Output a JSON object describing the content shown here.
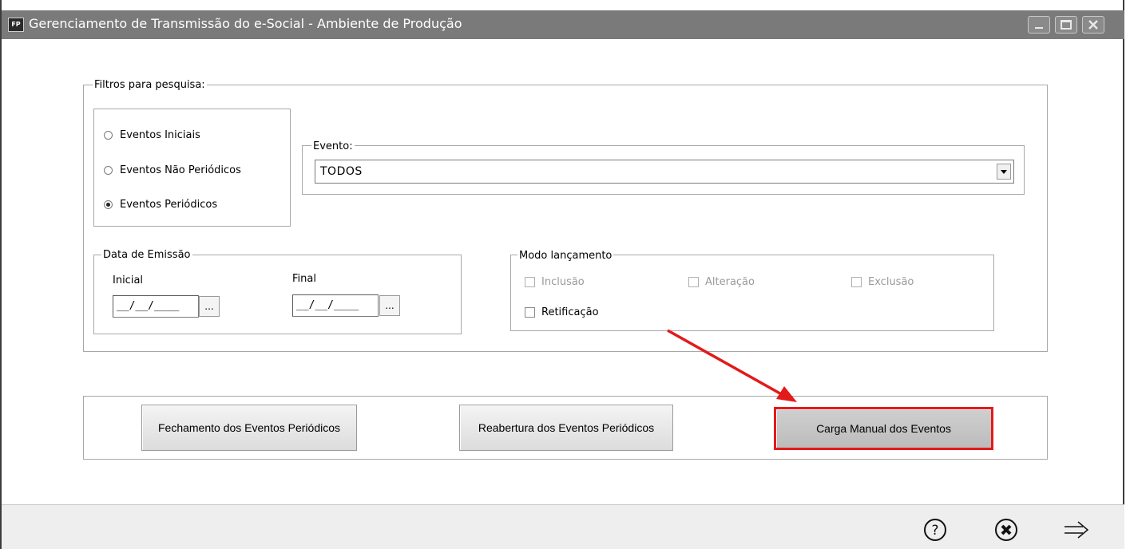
{
  "window": {
    "title": "Gerenciamento de Transmissão do e-Social - Ambiente de Produção",
    "app_icon": "FP"
  },
  "filters": {
    "legend": "Filtros para pesquisa:",
    "radios": [
      {
        "label": "Eventos Iniciais",
        "selected": false
      },
      {
        "label": "Eventos Não Periódicos",
        "selected": false
      },
      {
        "label": "Eventos Periódicos",
        "selected": true
      }
    ],
    "evento": {
      "legend": "Evento:",
      "value": "TODOS"
    }
  },
  "emissao": {
    "legend": "Data de Emissão",
    "inicial_label": "Inicial",
    "final_label": "Final",
    "inicial_value": "__/__/____",
    "final_value": "__/__/____",
    "ellipsis": "..."
  },
  "modo": {
    "legend": "Modo lançamento",
    "inclusao": "Inclusão",
    "alteracao": "Alteração",
    "exclusao": "Exclusão",
    "retificacao": "Retificação"
  },
  "actions": {
    "fechamento": "Fechamento dos Eventos Periódicos",
    "reabertura": "Reabertura dos Eventos Periódicos",
    "carga": "Carga Manual dos Eventos"
  },
  "footer": {
    "icons": [
      "help-icon",
      "cancel-icon",
      "next-arrow-icon"
    ]
  },
  "colors": {
    "highlight": "#e31a1a",
    "titlebar": "#7a7a7a"
  }
}
